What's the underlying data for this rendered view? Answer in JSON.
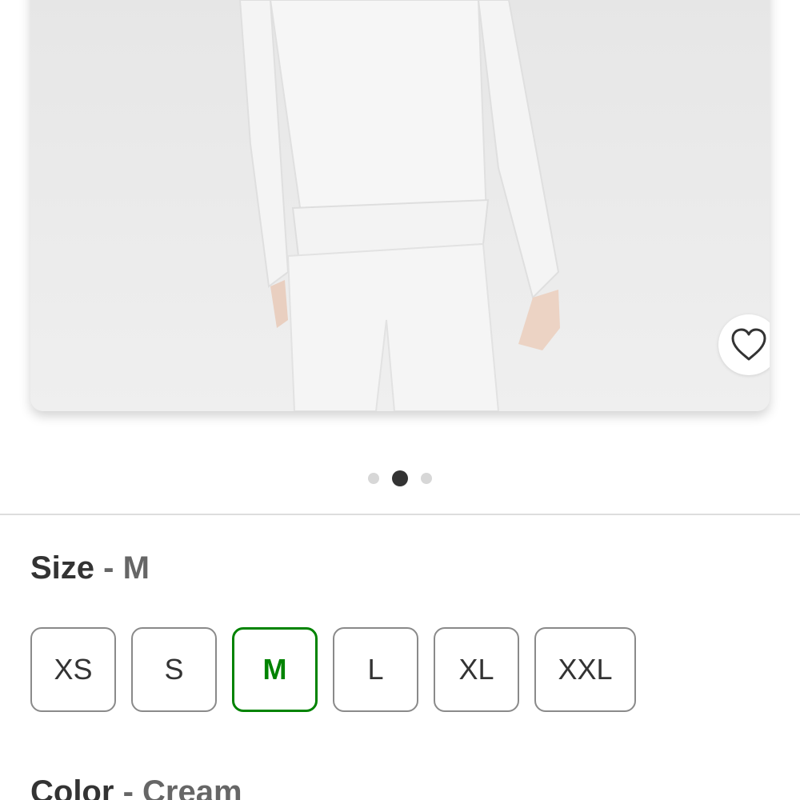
{
  "product": {
    "favorite": {
      "icon": "heart-outline-icon"
    }
  },
  "carousel": {
    "dot_count": 3,
    "active_index": 1
  },
  "size": {
    "label": "Size",
    "separator": "-",
    "selected": "M",
    "options": [
      "XS",
      "S",
      "M",
      "L",
      "XL",
      "XXL"
    ]
  },
  "color": {
    "label": "Color",
    "separator": "-",
    "selected": "Cream"
  },
  "colors": {
    "selected_accent": "#008300",
    "text": "#333333",
    "muted_text": "#666666",
    "border": "#8a8a8a"
  }
}
